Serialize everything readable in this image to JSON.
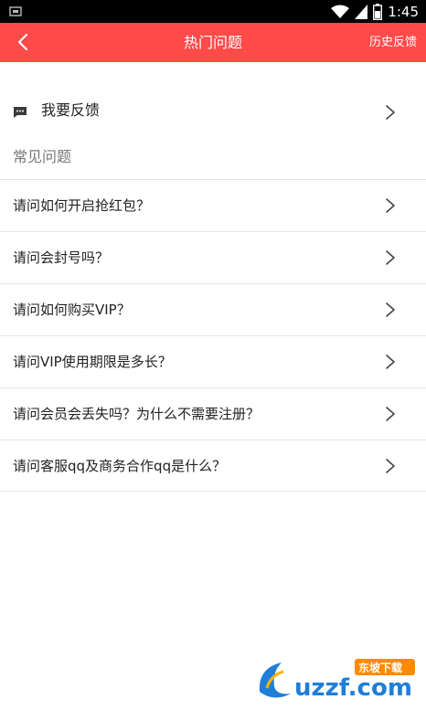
{
  "status_bar": {
    "time": "1:45",
    "icons": [
      "screenshot-icon",
      "wifi-icon",
      "signal-icon",
      "battery-icon"
    ]
  },
  "app_bar": {
    "title": "热门问题",
    "history_label": "历史反馈",
    "background_color": "#ff4a4a"
  },
  "feedback": {
    "label": "我要反馈",
    "icon": "chat-bubble-icon"
  },
  "section_header": "常见问题",
  "faq": [
    {
      "question": "请问如何开启抢红包？"
    },
    {
      "question": "请问会封号吗？"
    },
    {
      "question": "请问如何购买VIP？"
    },
    {
      "question": "请问VIP使用期限是多长？"
    },
    {
      "question": "请问会员会丢失吗？为什么不需要注册？"
    },
    {
      "question": "请问客服qq及商务合作qq是什么？"
    }
  ],
  "watermark": {
    "logo_text": "uzzf.com",
    "badge_text": "东坡下载"
  }
}
